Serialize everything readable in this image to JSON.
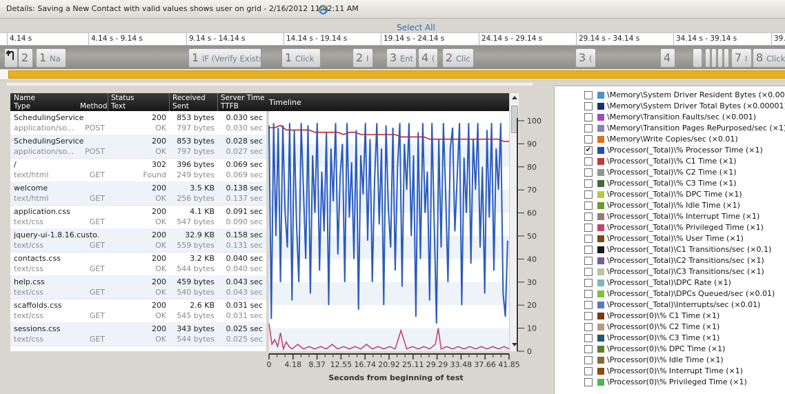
{
  "window": {
    "title": "Details: Saving a New Contact with valid values shows user on grid - 2/16/2012 11:42:11 AM"
  },
  "timeline_ribbon": {
    "select_all": "Select All",
    "ranges": [
      "4.14 s",
      "4.14 s - 9.14 s",
      "9.14 s - 14.14 s",
      "14.14 s - 19.14 s",
      "19.14 s - 24.14 s",
      "24.14 s - 29.14 s",
      "29.14 s - 34.14 s",
      "34.14 s - 39.14 s",
      "39."
    ],
    "steps": [
      {
        "num": "2",
        "label": ""
      },
      {
        "num": "1",
        "label": "Na"
      },
      {
        "num": "1",
        "label": "IF (Verify Exists"
      },
      {
        "num": "1",
        "label": "Click"
      },
      {
        "num": "2",
        "label": "I"
      },
      {
        "num": "3",
        "label": "Ent"
      },
      {
        "num": "4",
        "label": "("
      },
      {
        "num": "2",
        "label": "Clic"
      },
      {
        "num": "3",
        "label": "("
      },
      {
        "num": "4",
        "label": ""
      },
      {
        "num": "7",
        "label": "I"
      },
      {
        "num": "8",
        "label": "Click"
      }
    ]
  },
  "requests_grid": {
    "headers": {
      "name": "Name",
      "type": "Type",
      "method": "Method",
      "status": "Status",
      "status_text": "Text",
      "received": "Received",
      "sent": "Sent",
      "server_time": "Server Time",
      "ttfb": "TTFB",
      "timeline": "Timeline"
    },
    "rows": [
      {
        "name": "SchedulingService",
        "type": "application/so...",
        "method": "POST",
        "status": "200",
        "status_text": "OK",
        "received": "853 bytes",
        "sent": "797 bytes",
        "server_time": "0.030 sec",
        "ttfb": "0.030 sec"
      },
      {
        "name": "SchedulingService",
        "type": "application/so...",
        "method": "POST",
        "status": "200",
        "status_text": "OK",
        "received": "853 bytes",
        "sent": "797 bytes",
        "server_time": "0.028 sec",
        "ttfb": "0.027 sec"
      },
      {
        "name": "/",
        "type": "text/html",
        "method": "GET",
        "status": "302",
        "status_text": "Found",
        "received": "396 bytes",
        "sent": "249 bytes",
        "server_time": "0.069 sec",
        "ttfb": "0.069 sec"
      },
      {
        "name": "welcome",
        "type": "text/html",
        "method": "GET",
        "status": "200",
        "status_text": "OK",
        "received": "3.5 KB",
        "sent": "256 bytes",
        "server_time": "0.138 sec",
        "ttfb": "0.137 sec"
      },
      {
        "name": "application.css",
        "type": "text/css",
        "method": "GET",
        "status": "200",
        "status_text": "OK",
        "received": "4.1 KB",
        "sent": "547 bytes",
        "server_time": "0.091 sec",
        "ttfb": "0.090 sec"
      },
      {
        "name": "jquery-ui-1.8.16.custo...",
        "type": "text/css",
        "method": "GET",
        "status": "200",
        "status_text": "OK",
        "received": "32.9 KB",
        "sent": "559 bytes",
        "server_time": "0.158 sec",
        "ttfb": "0.131 sec"
      },
      {
        "name": "contacts.css",
        "type": "text/css",
        "method": "GET",
        "status": "200",
        "status_text": "OK",
        "received": "3.2 KB",
        "sent": "544 bytes",
        "server_time": "0.040 sec",
        "ttfb": "0.040 sec"
      },
      {
        "name": "help.css",
        "type": "text/css",
        "method": "GET",
        "status": "200",
        "status_text": "OK",
        "received": "459 bytes",
        "sent": "540 bytes",
        "server_time": "0.043 sec",
        "ttfb": "0.043 sec"
      },
      {
        "name": "scaffolds.css",
        "type": "text/css",
        "method": "GET",
        "status": "200",
        "status_text": "OK",
        "received": "2.6 KB",
        "sent": "545 bytes",
        "server_time": "0.031 sec",
        "ttfb": "0.031 sec"
      },
      {
        "name": "sessions.css",
        "type": "text/css",
        "method": "GET",
        "status": "200",
        "status_text": "OK",
        "received": "343 bytes",
        "sent": "544 bytes",
        "server_time": "0.025 sec",
        "ttfb": "0.025 sec"
      }
    ]
  },
  "chart_data": {
    "type": "line",
    "xlabel": "Seconds from beginning of test",
    "xlim": [
      0,
      41.85
    ],
    "ylim": [
      0,
      100
    ],
    "x_ticks": [
      0,
      4.18,
      8.37,
      12.55,
      16.74,
      20.92,
      25.11,
      29.29,
      33.48,
      37.66,
      41.85
    ],
    "x_tick_labels": [
      "0",
      "4.18",
      "8.37",
      "12.55",
      "16.74",
      "20.92",
      "25.11",
      "29.29",
      "33.48",
      "37.66",
      "41.85"
    ],
    "y_ticks": [
      0,
      10,
      20,
      30,
      40,
      50,
      60,
      70,
      80,
      90,
      100
    ],
    "y_tick_labels": [
      "0",
      "10",
      "20",
      "30",
      "40",
      "50",
      "60",
      "70",
      "80",
      "90",
      "100"
    ],
    "grid": "horizontal bands",
    "series": [
      {
        "color": "#2a5bbd",
        "x": [
          0.0,
          0.4,
          0.8,
          1.2,
          1.6,
          2.0,
          2.4,
          2.8,
          3.2,
          3.6,
          4.0,
          4.4,
          4.8,
          5.2,
          5.6,
          6.0,
          6.4,
          6.8,
          7.2,
          7.6,
          8.0,
          8.4,
          8.8,
          9.2,
          9.6,
          10.0,
          10.4,
          10.8,
          11.2,
          11.6,
          12.0,
          12.4,
          12.8,
          13.2,
          13.6,
          14.0,
          14.4,
          14.8,
          15.2,
          15.6,
          16.0,
          16.4,
          16.8,
          17.2,
          17.6,
          18.0,
          18.4,
          18.8,
          19.2,
          19.6,
          20.0,
          20.4,
          20.8,
          21.2,
          21.6,
          22.0,
          22.4,
          22.8,
          23.2,
          23.6,
          24.0,
          24.4,
          24.8,
          25.2,
          25.6,
          26.0,
          26.4,
          26.8,
          27.2,
          27.6,
          28.0,
          28.4,
          28.8,
          29.2,
          29.6,
          30.0,
          30.4,
          30.8,
          31.2,
          31.6,
          32.0,
          32.4,
          32.8,
          33.2,
          33.6,
          34.0,
          34.4,
          34.8,
          35.2,
          35.6,
          36.0,
          36.4,
          36.8,
          37.2,
          37.6,
          38.0,
          38.4,
          38.8,
          39.2,
          39.6,
          40.0,
          40.4,
          40.8,
          41.2,
          41.6
        ],
        "y": [
          98,
          14,
          99,
          50,
          97,
          30,
          98,
          60,
          45,
          99,
          22,
          96,
          55,
          30,
          99,
          70,
          40,
          98,
          25,
          85,
          60,
          99,
          35,
          78,
          52,
          95,
          20,
          88,
          65,
          99,
          42,
          76,
          90,
          30,
          99,
          58,
          82,
          40,
          96,
          18,
          85,
          68,
          99,
          48,
          92,
          30,
          74,
          99,
          55,
          88,
          20,
          98,
          62,
          45,
          97,
          35,
          80,
          99,
          28,
          90,
          70,
          99,
          50,
          85,
          15,
          95,
          40,
          99,
          60,
          78,
          22,
          99,
          55,
          12,
          92,
          45,
          99,
          68,
          30,
          88,
          97,
          52,
          75,
          99,
          20,
          84,
          60,
          99,
          38,
          92,
          70,
          99,
          45,
          80,
          25,
          96,
          58,
          99,
          35,
          88,
          70,
          99,
          25,
          15,
          48
        ]
      },
      {
        "color": "#b52a35",
        "x": [
          0.0,
          1.0,
          2.0,
          3.0,
          4.0,
          5.0,
          6.0,
          7.0,
          8.0,
          9.0,
          10.0,
          11.0,
          12.0,
          13.0,
          14.0,
          15.0,
          16.0,
          17.0,
          18.0,
          19.0,
          20.0,
          21.0,
          22.0,
          23.0,
          24.0,
          25.0,
          26.0,
          27.0,
          28.0,
          29.0,
          30.0,
          31.0,
          32.0,
          33.0,
          34.0,
          35.0,
          36.0,
          37.0,
          38.0,
          39.0,
          40.0,
          41.0,
          41.85
        ],
        "y": [
          97,
          97,
          98,
          96,
          96,
          96,
          96,
          96,
          95,
          95,
          95,
          95,
          95,
          94,
          95,
          95,
          94,
          94,
          94,
          94,
          94,
          94,
          94,
          93,
          93,
          93,
          93,
          93,
          92,
          92,
          92,
          92,
          92,
          92,
          92,
          92,
          92,
          92,
          92,
          92,
          92,
          91,
          91
        ]
      },
      {
        "color": "#c2446f",
        "x": [
          0.0,
          0.5,
          1.0,
          1.5,
          2.0,
          2.5,
          3.0,
          3.5,
          4.0,
          5.0,
          6.0,
          7.0,
          8.0,
          9.0,
          10.0,
          11.0,
          12.0,
          13.0,
          14.0,
          15.0,
          16.0,
          17.0,
          18.0,
          19.0,
          20.0,
          21.0,
          22.0,
          23.0,
          24.0,
          25.0,
          26.0,
          27.0,
          28.0,
          29.0,
          29.5,
          30.0,
          31.0,
          32.0,
          33.0,
          34.0,
          35.0,
          36.0,
          37.0,
          38.0,
          39.0,
          40.0,
          41.0,
          41.85
        ],
        "y": [
          12,
          3,
          5,
          2,
          8,
          1,
          4,
          2,
          1,
          3,
          1,
          2,
          1,
          2,
          1,
          3,
          1,
          2,
          1,
          2,
          1,
          3,
          1,
          2,
          1,
          2,
          1,
          9,
          1,
          2,
          1,
          2,
          1,
          3,
          10,
          1,
          2,
          1,
          2,
          1,
          2,
          1,
          2,
          1,
          2,
          1,
          2,
          1
        ]
      }
    ]
  },
  "counters": {
    "items": [
      {
        "label": "\\Memory\\System Driver Resident Bytes (×0.00001)",
        "color": "#4a90d4",
        "checked": false
      },
      {
        "label": "\\Memory\\System Driver Total Bytes (×0.00001)",
        "color": "#1c2c7a",
        "checked": false
      },
      {
        "label": "\\Memory\\Transition Faults/sec (×0.001)",
        "color": "#9b4fb4",
        "checked": false
      },
      {
        "label": "\\Memory\\Transition Pages RePurposed/sec (×1)",
        "color": "#8a7fbf",
        "checked": false
      },
      {
        "label": "\\Memory\\Write Copies/sec (×0.01)",
        "color": "#d1771f",
        "checked": false
      },
      {
        "label": "\\Processor(_Total)\\% Processor Time (×1)",
        "color": "#1f4fb4",
        "checked": true
      },
      {
        "label": "\\Processor(_Total)\\% C1 Time (×1)",
        "color": "#c23a3a",
        "checked": false
      },
      {
        "label": "\\Processor(_Total)\\% C2 Time (×1)",
        "color": "#8d9a8a",
        "checked": false
      },
      {
        "label": "\\Processor(_Total)\\% C3 Time (×1)",
        "color": "#3c6a3a",
        "checked": false
      },
      {
        "label": "\\Processor(_Total)\\% DPC Time (×1)",
        "color": "#b7c93f",
        "checked": false
      },
      {
        "label": "\\Processor(_Total)\\% Idle Time (×1)",
        "color": "#6c9a2a",
        "checked": false
      },
      {
        "label": "\\Processor(_Total)\\% Interrupt Time (×1)",
        "color": "#9a7a74",
        "checked": false
      },
      {
        "label": "\\Processor(_Total)\\% Privileged Time (×1)",
        "color": "#c2446f",
        "checked": false
      },
      {
        "label": "\\Processor(_Total)\\% User Time (×1)",
        "color": "#7a4a1a",
        "checked": false
      },
      {
        "label": "\\Processor(_Total)\\C1 Transitions/sec (×0.1)",
        "color": "#1a1a1a",
        "checked": false
      },
      {
        "label": "\\Processor(_Total)\\C2 Transitions/sec (×1)",
        "color": "#7a5a9a",
        "checked": false
      },
      {
        "label": "\\Processor(_Total)\\C3 Transitions/sec (×1)",
        "color": "#b9c4a0",
        "checked": false
      },
      {
        "label": "\\Processor(_Total)\\DPC Rate (×1)",
        "color": "#7ab8b0",
        "checked": false
      },
      {
        "label": "\\Processor(_Total)\\DPCs Queued/sec (×0.01)",
        "color": "#7ac43a",
        "checked": false
      },
      {
        "label": "\\Processor(_Total)\\Interrupts/sec (×0.01)",
        "color": "#5a7ab8",
        "checked": false
      },
      {
        "label": "\\Processor(0)\\% C1 Time (×1)",
        "color": "#7a3a10",
        "checked": false
      },
      {
        "label": "\\Processor(0)\\% C2 Time (×1)",
        "color": "#b89a7a",
        "checked": false
      },
      {
        "label": "\\Processor(0)\\% C3 Time (×1)",
        "color": "#1f5a6a",
        "checked": false
      },
      {
        "label": "\\Processor(0)\\% DPC Time (×1)",
        "color": "#6a7a2a",
        "checked": false
      },
      {
        "label": "\\Processor(0)\\% Idle Time (×1)",
        "color": "#8a6a3a",
        "checked": false
      },
      {
        "label": "\\Processor(0)\\% Interrupt Time (×1)",
        "color": "#8a4a10",
        "checked": false
      },
      {
        "label": "\\Processor(0)\\% Privileged Time (×1)",
        "color": "#4ab84a",
        "checked": false
      }
    ]
  }
}
